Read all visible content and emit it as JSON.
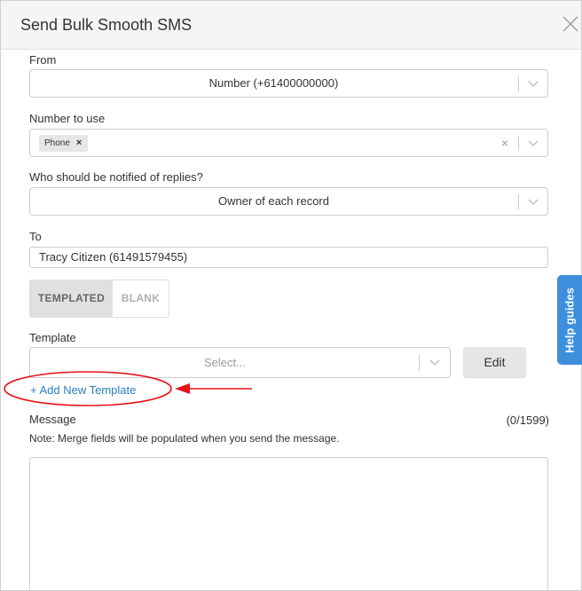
{
  "dialog": {
    "title": "Send Bulk Smooth SMS"
  },
  "from": {
    "label": "From",
    "value": "Number (+61400000000)"
  },
  "number_to_use": {
    "label": "Number to use",
    "tag": "Phone",
    "tag_remove": "×",
    "clear": "×"
  },
  "notify": {
    "label": "Who should be notified of replies?",
    "value": "Owner of each record"
  },
  "to": {
    "label": "To",
    "value": "Tracy Citizen (61491579455)"
  },
  "mode_toggle": {
    "templated": "TEMPLATED",
    "blank": "BLANK",
    "selected": "TEMPLATED"
  },
  "template": {
    "label": "Template",
    "placeholder": "Select...",
    "edit_label": "Edit",
    "add_link": "+ Add New Template"
  },
  "message": {
    "label": "Message",
    "counter": "(0/1599)",
    "note": "Note: Merge fields will be populated when you send the message.",
    "value": ""
  },
  "help_tab": {
    "label": "Help guides"
  },
  "annotation": {
    "color": "#e8121a"
  },
  "colors": {
    "link": "#2a7ec4",
    "help_tab": "#3d8fdc",
    "toggle_active": "#e0e0e0"
  }
}
